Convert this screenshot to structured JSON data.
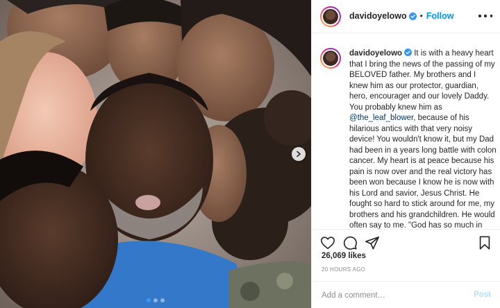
{
  "post": {
    "username": "davidoyelowo",
    "separator": "•",
    "follow_label": "Follow",
    "verified_color": "#3897f0",
    "more_icon": "more-options-icon"
  },
  "photo": {
    "alt": "family-kissing-elderly-man",
    "carousel_count": 3,
    "carousel_active": 1,
    "next_icon": "chevron-right-icon"
  },
  "caption": {
    "text_a": " It is with a heavy heart that I bring the news of the passing of my BELOVED father. My brothers and I knew him as our protector, guardian, hero, encourager and our lovely Daddy. You probably knew him as ",
    "mention": "@the_leaf_blower",
    "text_b": ", because of his hilarious antics with that very noisy device! You wouldn't know it, but my Dad had been in a years long battle with colon cancer. My heart is at peace because his pain is now over and the real victory has been won because I know he is now with his Lord and savior, Jesus Christ. He fought so hard to stick around for me, my brothers and his grandchildren. He would often say to me. \"God has so much in store for you, and I"
  },
  "actions": {
    "icons": [
      "heart-icon",
      "comment-icon",
      "share-icon",
      "bookmark-icon"
    ]
  },
  "stats": {
    "likes": "26,069 likes",
    "timestamp": "20 HOURS AGO"
  },
  "comment": {
    "placeholder": "Add a comment…",
    "post_label": "Post"
  },
  "colors": {
    "accent": "#0095f6",
    "post_disabled": "#b2dffc",
    "muted": "#8e8e8e",
    "mention": "#00376b"
  }
}
